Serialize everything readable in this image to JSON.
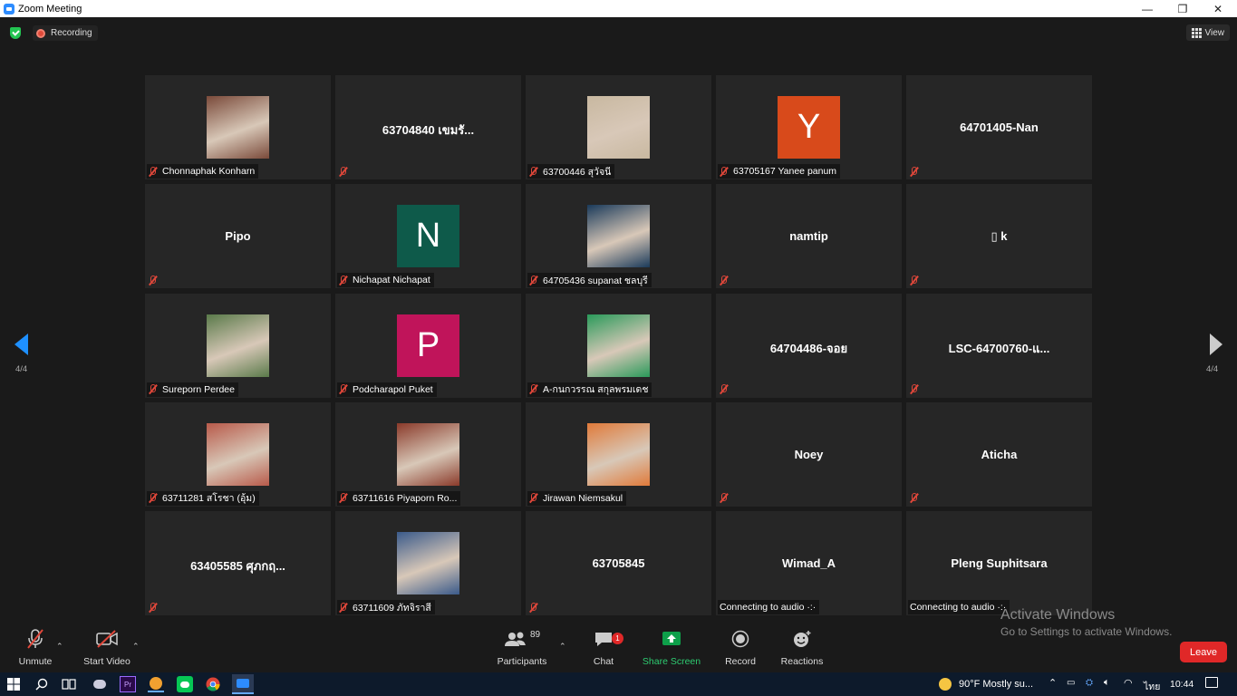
{
  "window": {
    "title": "Zoom Meeting",
    "controls": [
      "—",
      "❐",
      "✕"
    ]
  },
  "topbar": {
    "recording_label": "Recording",
    "view_label": "View"
  },
  "participants": [
    {
      "name": "",
      "plate": "Chonnaphak Konharn",
      "type": "photo",
      "color": "#7a4a3a"
    },
    {
      "name": "63704840 เขมรั...",
      "plate": "",
      "type": "name"
    },
    {
      "name": "",
      "plate": "63700446 สุวัจนี",
      "type": "photo",
      "color": "#c8b8a0"
    },
    {
      "name": "",
      "plate": "63705167 Yanee panum",
      "type": "letter",
      "letter": "Y",
      "color": "#d84a1b"
    },
    {
      "name": "64701405-Nan",
      "plate": "",
      "type": "name"
    },
    {
      "name": "Pipo",
      "plate": "",
      "type": "name"
    },
    {
      "name": "",
      "plate": "Nichapat Nichapat",
      "type": "letter",
      "letter": "N",
      "color": "#0e5a4a"
    },
    {
      "name": "",
      "plate": "64705436 supanat ชลบุรี",
      "type": "photo",
      "color": "#1a3a5a"
    },
    {
      "name": "namtip",
      "plate": "",
      "type": "name"
    },
    {
      "name": "▯ k",
      "plate": "",
      "type": "name"
    },
    {
      "name": "",
      "plate": "Sureporn Perdee",
      "type": "photo",
      "color": "#5a7a4a"
    },
    {
      "name": "",
      "plate": "Podcharapol Puket",
      "type": "letter",
      "letter": "P",
      "color": "#c0145a"
    },
    {
      "name": "",
      "plate": "A-กนกวรรณ สกุลพรมเดช",
      "type": "photo",
      "color": "#2a9a5a"
    },
    {
      "name": "64704486-จอย",
      "plate": "",
      "type": "name"
    },
    {
      "name": "LSC-64700760-แ...",
      "plate": "",
      "type": "name"
    },
    {
      "name": "",
      "plate": "63711281 สโรชา (อุ้ม)",
      "type": "photo",
      "color": "#b85a4a"
    },
    {
      "name": "",
      "plate": "63711616 Piyaporn Ro...",
      "type": "photo",
      "color": "#8a3a2a"
    },
    {
      "name": "",
      "plate": "Jirawan Niemsakul",
      "type": "photo",
      "color": "#e07a3a"
    },
    {
      "name": "Noey",
      "plate": "",
      "type": "name"
    },
    {
      "name": "Aticha",
      "plate": "",
      "type": "name"
    },
    {
      "name": "63405585 ศุภกฤ...",
      "plate": "",
      "type": "name"
    },
    {
      "name": "",
      "plate": "63711609 ภัทจิราสี",
      "type": "photo",
      "color": "#3a5a8a"
    },
    {
      "name": "63705845",
      "plate": "",
      "type": "name"
    },
    {
      "name": "Wimad_A",
      "plate": "Connecting to audio ·:·",
      "type": "name",
      "nomute": true
    },
    {
      "name": "Pleng Suphitsara",
      "plate": "Connecting to audio ·:·",
      "type": "name",
      "nomute": true
    }
  ],
  "pagination": {
    "left": "4/4",
    "right": "4/4"
  },
  "toolbar": {
    "unmute": "Unmute",
    "start_video": "Start Video",
    "participants_label": "Participants",
    "participants_count": "89",
    "chat": "Chat",
    "chat_badge": "1",
    "share": "Share Screen",
    "record": "Record",
    "reactions": "Reactions",
    "leave": "Leave"
  },
  "watermark": {
    "line1": "Activate Windows",
    "line2": "Go to Settings to activate Windows."
  },
  "taskbar": {
    "weather": "90°F  Mostly su...",
    "lang": "ไทย",
    "time": "10:44"
  },
  "colors": {
    "accent_green": "#0e9f4a",
    "leave_red": "#e02828",
    "nav_blue": "#1e90ff"
  }
}
